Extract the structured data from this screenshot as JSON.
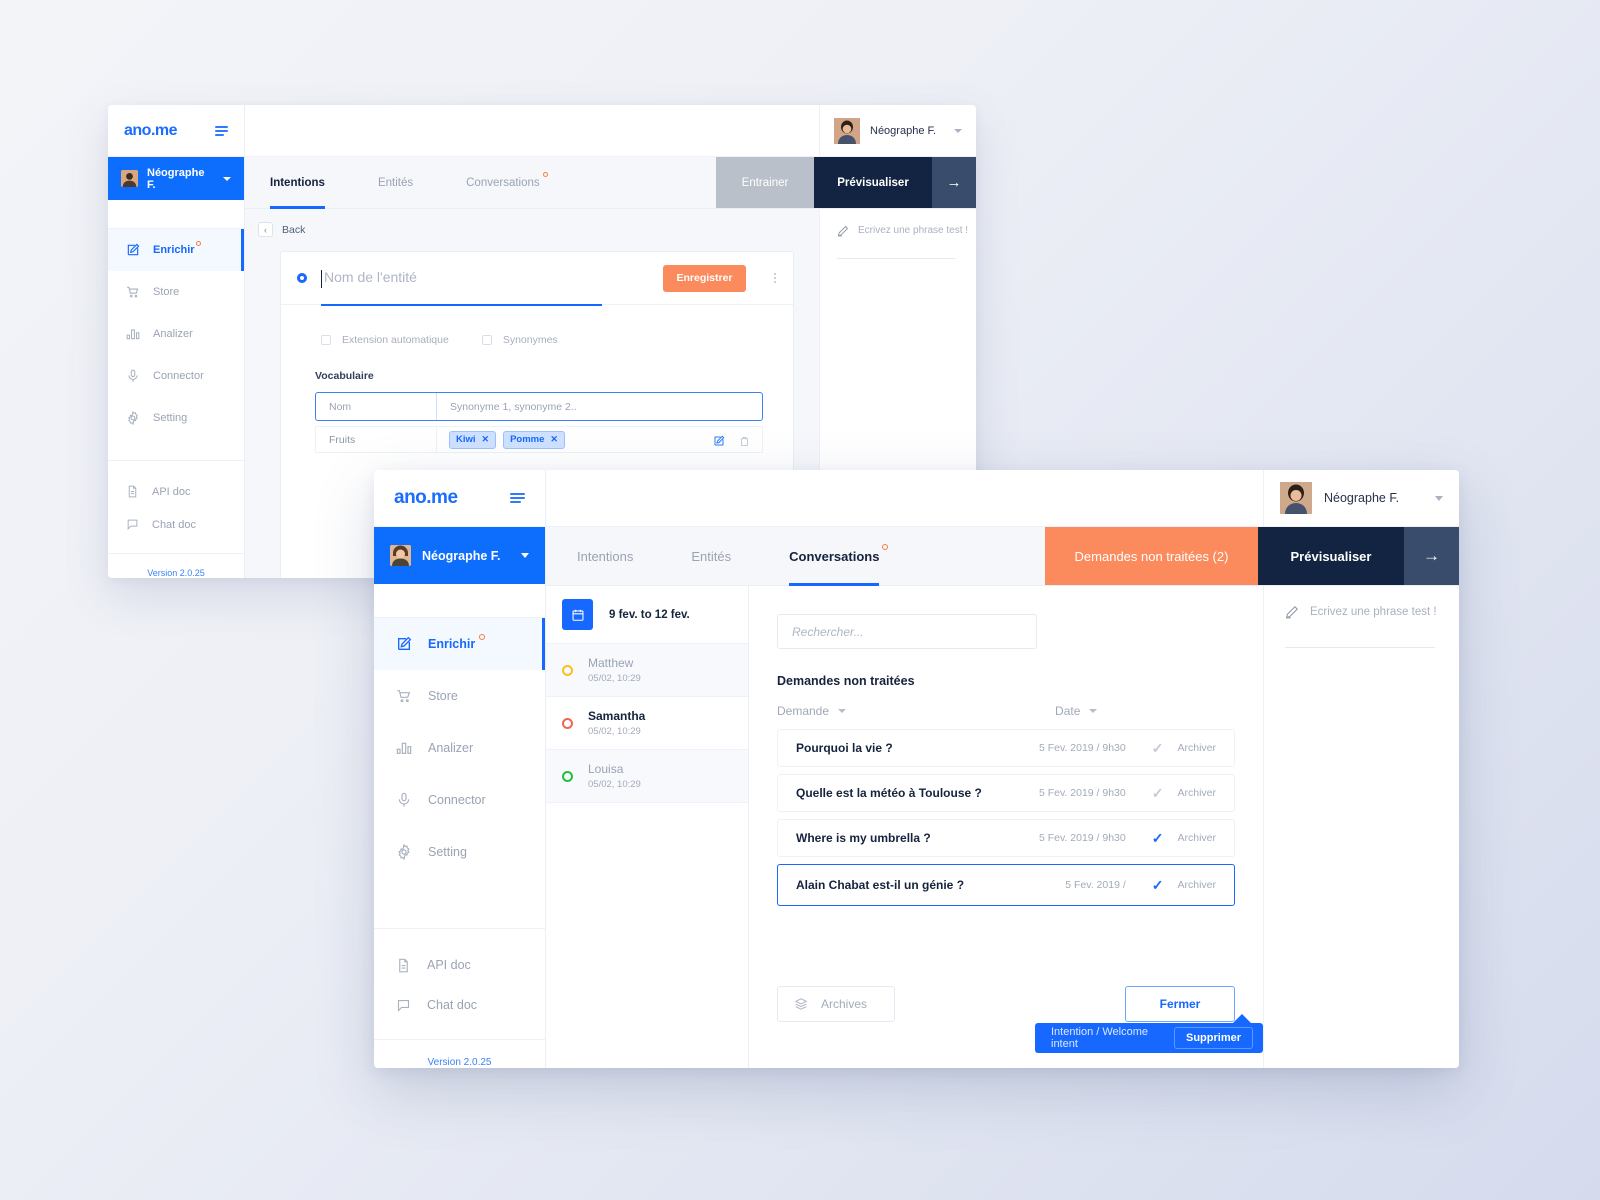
{
  "brand": {
    "name": "ano.me"
  },
  "version_label": "Version 2.0.25",
  "user": {
    "name": "Néographe F."
  },
  "sidebar": {
    "items": [
      {
        "label": "Enrichir",
        "icon": "edit-square-icon",
        "active": true,
        "badge": true
      },
      {
        "label": "Store",
        "icon": "cart-icon",
        "active": false,
        "badge": false
      },
      {
        "label": "Analizer",
        "icon": "bar-chart-icon",
        "active": false,
        "badge": false
      },
      {
        "label": "Connector",
        "icon": "microphone-icon",
        "active": false,
        "badge": false
      },
      {
        "label": "Setting",
        "icon": "gear-icon",
        "active": false,
        "badge": false
      }
    ],
    "docs": [
      {
        "label": "API doc",
        "icon": "document-icon"
      },
      {
        "label": "Chat doc",
        "icon": "chat-doc-icon"
      }
    ]
  },
  "window1": {
    "tabs": [
      {
        "label": "Intentions",
        "active": true,
        "badge": false
      },
      {
        "label": "Entités",
        "active": false,
        "badge": false
      },
      {
        "label": "Conversations",
        "active": false,
        "badge": true
      }
    ],
    "train_button": "Entrainer",
    "preview_button": "Prévisualiser",
    "arrow_button": "→",
    "back_label": "Back",
    "entity": {
      "name_placeholder": "Nom de l'entité",
      "save_button": "Enregistrer",
      "checkbox_auto": "Extension automatique",
      "checkbox_syn": "Synonymes",
      "vocab_title": "Vocabulaire",
      "head_name_placeholder": "Nom",
      "head_syn_placeholder": "Synonyme 1, synonyme 2..",
      "rows": [
        {
          "name": "Fruits",
          "chips": [
            "Kiwi",
            "Pomme"
          ]
        }
      ]
    },
    "test_placeholder": "Ecrivez une phrase test !"
  },
  "window2": {
    "tabs": [
      {
        "label": "Intentions",
        "active": false,
        "badge": false
      },
      {
        "label": "Entités",
        "active": false,
        "badge": false
      },
      {
        "label": "Conversations",
        "active": true,
        "badge": true
      }
    ],
    "pending_button": "Demandes non traitées (2)",
    "preview_button": "Prévisualiser",
    "arrow_button": "→",
    "date_range": "9 fev. to 12 fev.",
    "conversations": [
      {
        "name": "Matthew",
        "time": "05/02, 10:29",
        "status_color": "#f7c21b",
        "selected": false
      },
      {
        "name": "Samantha",
        "time": "05/02, 10:29",
        "status_color": "#f4634f",
        "selected": true
      },
      {
        "name": "Louisa",
        "time": "05/02, 10:29",
        "status_color": "#1fbf3b",
        "selected": false
      }
    ],
    "search_placeholder": "Rechercher...",
    "section_title": "Demandes non traitées",
    "columns": {
      "demande": "Demande",
      "date": "Date"
    },
    "requests": [
      {
        "question": "Pourquoi la vie ?",
        "date": "5 Fev. 2019 / 9h30",
        "archive": "Archiver",
        "checked": false,
        "selected": false
      },
      {
        "question": "Quelle est la météo à Toulouse ?",
        "date": "5 Fev. 2019 / 9h30",
        "archive": "Archiver",
        "checked": false,
        "selected": false
      },
      {
        "question": "Where is my umbrella ?",
        "date": "5 Fev. 2019 / 9h30",
        "archive": "Archiver",
        "checked": true,
        "selected": false
      },
      {
        "question": "Alain Chabat est-il un génie ?",
        "date": "5 Fev. 2019 /",
        "archive": "Archiver",
        "checked": true,
        "selected": true
      }
    ],
    "tooltip": {
      "text": "Intention / Welcome intent",
      "button": "Supprimer"
    },
    "archives_button": "Archives",
    "close_button": "Fermer",
    "test_placeholder": "Ecrivez une phrase test !"
  },
  "colors": {
    "brand_blue": "#1668ff",
    "orange": "#fb8a5d",
    "dark_navy": "#122441",
    "gray_btn": "#b9c0ca"
  }
}
